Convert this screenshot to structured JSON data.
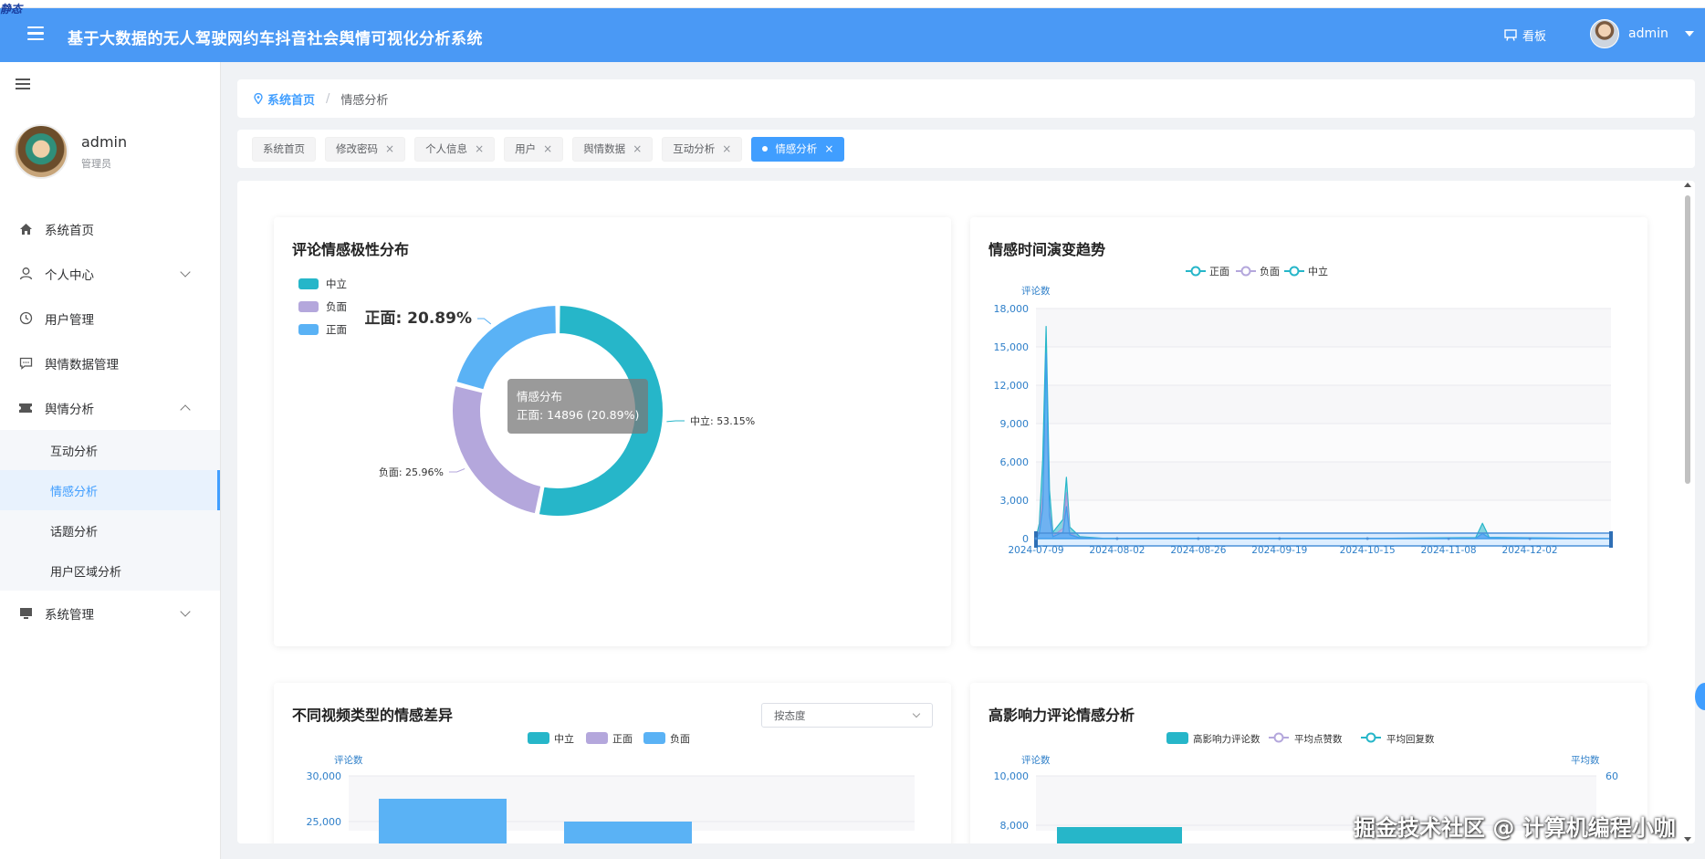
{
  "corner_mark": "静态",
  "header": {
    "app_title": "基于大数据的无人驾驶网约车抖音社会舆情可视化分析系统",
    "kanban_label": "看板",
    "username": "admin"
  },
  "sidebar": {
    "profile_name": "admin",
    "profile_role": "管理员",
    "items": [
      {
        "label": "系统首页",
        "icon": "home-icon"
      },
      {
        "label": "个人中心",
        "icon": "user-icon",
        "expand": "down"
      },
      {
        "label": "用户管理",
        "icon": "clock-icon"
      },
      {
        "label": "舆情数据管理",
        "icon": "chat-icon"
      },
      {
        "label": "舆情分析",
        "icon": "ticket-icon",
        "expand": "up"
      },
      {
        "label": "系统管理",
        "icon": "monitor-icon",
        "expand": "down"
      }
    ],
    "sub_items": [
      "互动分析",
      "情感分析",
      "话题分析",
      "用户区域分析"
    ]
  },
  "breadcrumb": {
    "home": "系统首页",
    "separator": "/",
    "current": "情感分析"
  },
  "tags": [
    {
      "label": "系统首页",
      "closable": false
    },
    {
      "label": "修改密码",
      "closable": true
    },
    {
      "label": "个人信息",
      "closable": true
    },
    {
      "label": "用户",
      "closable": true
    },
    {
      "label": "舆情数据",
      "closable": true
    },
    {
      "label": "互动分析",
      "closable": true
    },
    {
      "label": "情感分析",
      "closable": true,
      "active": true
    }
  ],
  "tag_close": "×",
  "colors": {
    "header": "#4a99f5",
    "accent": "#409eff",
    "neutral": "#26b6c9",
    "negative": "#b4a7dc",
    "positive": "#5ab2f5"
  },
  "cards": {
    "pie_title": "评论情感极性分布",
    "trend_title": "情感时间演变趋势",
    "video_title": "不同视频类型的情感差异",
    "impact_title": "高影响力评论情感分析",
    "video_select": "按态度"
  },
  "tooltip": {
    "title": "情感分布",
    "line": "正面: 14896 (20.89%)"
  },
  "watermark": "掘金技术社区 @ 计算机编程小咖",
  "chart_data": [
    {
      "type": "pie",
      "title": "评论情感极性分布",
      "series_name": "情感分布",
      "legend": [
        "中立",
        "负面",
        "正面"
      ],
      "slices": [
        {
          "name": "中立",
          "percent": 53.15,
          "label": "中立: 53.15%"
        },
        {
          "name": "负面",
          "percent": 25.96,
          "label": "负面: 25.96%"
        },
        {
          "name": "正面",
          "percent": 20.89,
          "label": "正面: 20.89%",
          "value": 14896
        }
      ],
      "donut": true
    },
    {
      "type": "area",
      "title": "情感时间演变趋势",
      "ylabel": "评论数",
      "legend": [
        "正面",
        "负面",
        "中立"
      ],
      "yticks": [
        "0",
        "3,000",
        "6,000",
        "9,000",
        "12,000",
        "15,000",
        "18,000"
      ],
      "ylim": [
        0,
        18000
      ],
      "xticks": [
        "2024-07-09",
        "2024-08-02",
        "2024-08-26",
        "2024-09-19",
        "2024-10-15",
        "2024-11-08",
        "2024-12-02"
      ],
      "x_range_days": [
        0,
        170
      ],
      "series": [
        {
          "name": "正面",
          "points": [
            [
              0,
              0
            ],
            [
              1,
              400
            ],
            [
              2,
              2400
            ],
            [
              3,
              14500
            ],
            [
              4,
              1800
            ],
            [
              5,
              150
            ],
            [
              8,
              500
            ],
            [
              9,
              2500
            ],
            [
              10,
              300
            ],
            [
              13,
              50
            ],
            [
              20,
              0
            ],
            [
              37,
              20
            ],
            [
              100,
              10
            ],
            [
              130,
              30
            ],
            [
              132,
              400
            ],
            [
              134,
              60
            ],
            [
              170,
              0
            ]
          ]
        },
        {
          "name": "负面",
          "points": [
            [
              0,
              0
            ],
            [
              1,
              600
            ],
            [
              2,
              3500
            ],
            [
              3,
              9000
            ],
            [
              4,
              2200
            ],
            [
              5,
              200
            ],
            [
              8,
              800
            ],
            [
              9,
              3600
            ],
            [
              10,
              400
            ],
            [
              13,
              60
            ],
            [
              20,
              0
            ],
            [
              37,
              10
            ],
            [
              100,
              10
            ],
            [
              130,
              20
            ],
            [
              132,
              300
            ],
            [
              134,
              40
            ],
            [
              170,
              0
            ]
          ]
        },
        {
          "name": "中立",
          "points": [
            [
              0,
              0
            ],
            [
              1,
              1200
            ],
            [
              2,
              6200
            ],
            [
              3,
              16600
            ],
            [
              4,
              3800
            ],
            [
              5,
              500
            ],
            [
              8,
              1500
            ],
            [
              9,
              4800
            ],
            [
              10,
              900
            ],
            [
              13,
              150
            ],
            [
              20,
              20
            ],
            [
              37,
              30
            ],
            [
              100,
              20
            ],
            [
              130,
              80
            ],
            [
              132,
              1200
            ],
            [
              134,
              100
            ],
            [
              170,
              0
            ]
          ]
        }
      ]
    },
    {
      "type": "bar",
      "title": "不同视频类型的情感差异",
      "ylabel": "评论数",
      "legend": [
        "中立",
        "正面",
        "负面"
      ],
      "yticks": [
        "25,000",
        "30,000"
      ],
      "visible_ylim": [
        24000,
        30000
      ],
      "categories_visible_values": [
        27500,
        25000
      ]
    },
    {
      "type": "bar",
      "title": "高影响力评论情感分析",
      "ylabel": "评论数",
      "ylabel_right": "平均数",
      "legend": [
        "高影响力评论数",
        "平均点赞数",
        "平均回复数"
      ],
      "yticks": [
        "8,000",
        "10,000"
      ],
      "yticks_right": [
        "60"
      ]
    }
  ]
}
